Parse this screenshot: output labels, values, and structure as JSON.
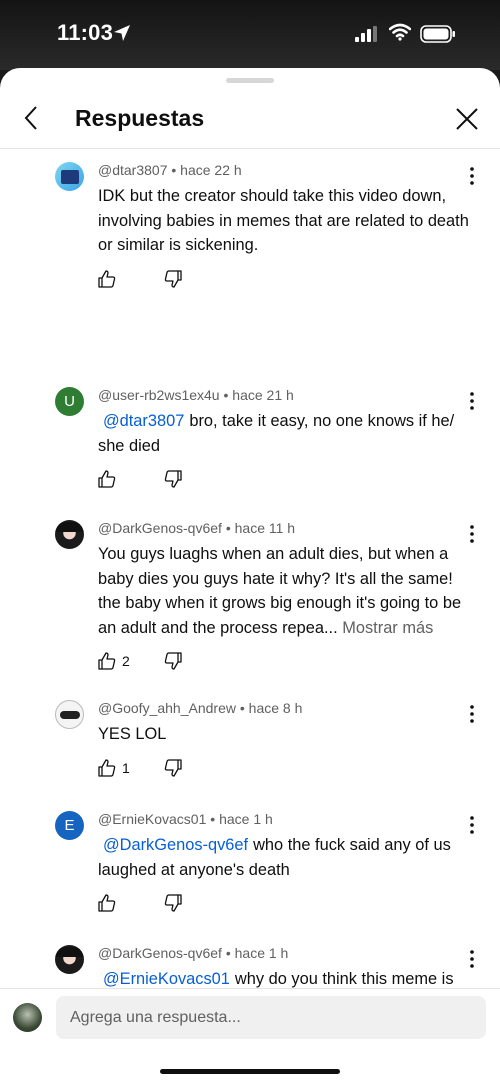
{
  "status_bar": {
    "time": "11:03"
  },
  "header": {
    "title": "Respuestas"
  },
  "comments": [
    {
      "author": "@dtar3807",
      "time": "hace 22 h",
      "text": "IDK but the creator should take this video down, involving babies in memes that are related to death or similar is sickening.",
      "likes": ""
    },
    {
      "author": "@user-rb2ws1ex4u",
      "time": "hace 21 h",
      "mention": "@dtar3807",
      "text": "bro, take it easy, no one knows if he/ she died",
      "likes": ""
    },
    {
      "author": "@DarkGenos-qv6ef",
      "time": "hace 11 h",
      "text": "You guys luaghs when an adult dies, but when a baby dies you guys hate it why? It's all the same! the baby when it grows big enough it's going to be an adult and the process repea...",
      "show_more": "Mostrar más",
      "likes": "2"
    },
    {
      "author": "@Goofy_ahh_Andrew",
      "time": "hace 8 h",
      "text": "YES LOL",
      "likes": "1"
    },
    {
      "author": "@ErnieKovacs01",
      "time": "hace 1 h",
      "mention": "@DarkGenos-qv6ef",
      "text": "who the fuck said any of us laughed at anyone's death",
      "likes": ""
    },
    {
      "author": "@DarkGenos-qv6ef",
      "time": "hace 1 h",
      "mention": "@ErnieKovacs01",
      "text": "why do you think this meme is going? Huh?! ITS FOR AMUSEMENT!!! for these people's amusements! Not just this here!",
      "likes": ""
    }
  ],
  "avatars": {
    "user_rb2ws1ex4u_letter": "U",
    "erniekovacs01_letter": "E"
  },
  "footer": {
    "reply_placeholder": "Agrega una respuesta..."
  },
  "colors": {
    "mention": "#065fd4",
    "meta": "#606060",
    "avatar_u": "#2e7d32",
    "avatar_e": "#1565c0"
  }
}
